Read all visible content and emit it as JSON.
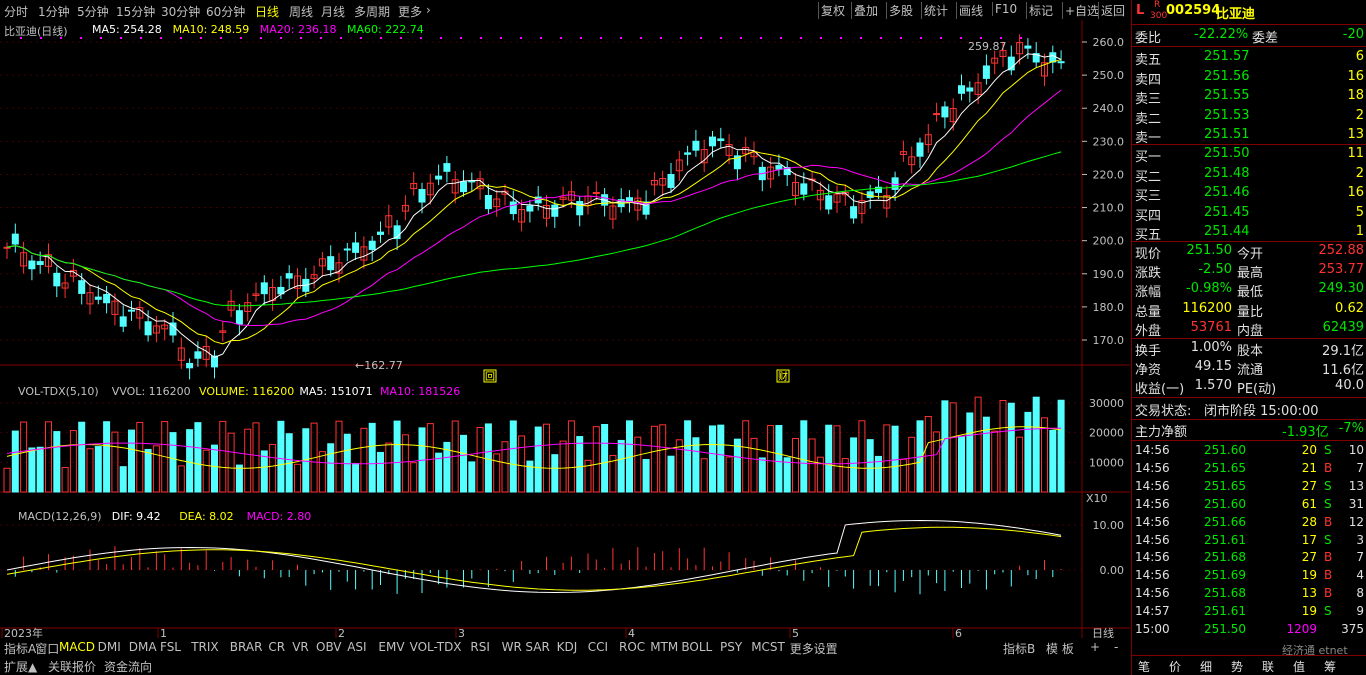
{
  "toolbar": {
    "timeframes": [
      "分时",
      "1分钟",
      "5分钟",
      "15分钟",
      "30分钟",
      "60分钟",
      "日线",
      "周线",
      "月线",
      "多周期",
      "更多"
    ],
    "active_timeframe": "日线",
    "buttons": [
      "复权",
      "叠加",
      "多股",
      "统计",
      "画线",
      "F10",
      "标记",
      "+自选",
      "返回"
    ]
  },
  "chart": {
    "title": "比亚迪(日线)",
    "ma_legend": [
      {
        "label": "MA5: 254.28",
        "color": "#ffffff"
      },
      {
        "label": "MA10: 248.59",
        "color": "#ffff00"
      },
      {
        "label": "MA20: 236.18",
        "color": "#ff00ff"
      },
      {
        "label": "MA60: 222.74",
        "color": "#00ff00"
      }
    ],
    "high_label": "259.87",
    "low_label": "162.77",
    "event_markers": [
      "回",
      "财"
    ],
    "price_ticks": [
      "260.0",
      "250.0",
      "240.0",
      "230.0",
      "220.0",
      "210.0",
      "200.0",
      "190.0",
      "180.0",
      "170.0"
    ],
    "vol_legend": [
      {
        "label": "VOL-TDX(5,10)",
        "color": "#c0c0c0"
      },
      {
        "label": "VVOL: 116200",
        "color": "#c0c0c0"
      },
      {
        "label": "VOLUME: 116200",
        "color": "#ffff00"
      },
      {
        "label": "MA5: 151071",
        "color": "#ffffff"
      },
      {
        "label": "MA10: 181526",
        "color": "#ff00ff"
      }
    ],
    "vol_ticks": [
      "30000",
      "20000",
      "10000"
    ],
    "vol_unit": "X10",
    "macd_legend": [
      {
        "label": "MACD(12,26,9)",
        "color": "#c0c0c0"
      },
      {
        "label": "DIF: 9.42",
        "color": "#ffffff"
      },
      {
        "label": "DEA: 8.02",
        "color": "#ffff00"
      },
      {
        "label": "MACD: 2.80",
        "color": "#ff00ff"
      }
    ],
    "macd_ticks": [
      "10.00",
      "0.00"
    ],
    "x_labels": [
      "2023年",
      "1",
      "2",
      "3",
      "4",
      "5",
      "6"
    ],
    "x_axis_unit": "日线"
  },
  "bottom": {
    "indicators": [
      "指标A",
      "窗口",
      "MACD",
      "DMI",
      "DMA",
      "FSL",
      "TRIX",
      "BRAR",
      "CR",
      "VR",
      "OBV",
      "ASI",
      "EMV",
      "VOL-TDX",
      "RSI",
      "WR",
      "SAR",
      "KDJ",
      "CCI",
      "ROC",
      "MTM",
      "BOLL",
      "PSY",
      "MCST",
      "更多",
      "设置"
    ],
    "active_indicator": "MACD",
    "right_tabs": [
      "指标B",
      "模 板"
    ],
    "row2": [
      "扩展▲",
      "关联报价",
      "资金流向"
    ],
    "corner": [
      "+",
      "-"
    ]
  },
  "quote": {
    "badge": "L",
    "r_mark": "R",
    "index_mark": "300",
    "code": "002594",
    "name": "比亚迪",
    "weibi_label": "委比",
    "weibi": "-22.22%",
    "weicha_label": "委差",
    "weicha": "-20",
    "asks": [
      {
        "label": "卖五",
        "price": "251.57",
        "vol": "6"
      },
      {
        "label": "卖四",
        "price": "251.56",
        "vol": "16"
      },
      {
        "label": "卖三",
        "price": "251.55",
        "vol": "18"
      },
      {
        "label": "卖二",
        "price": "251.53",
        "vol": "2"
      },
      {
        "label": "卖一",
        "price": "251.51",
        "vol": "13"
      }
    ],
    "bids": [
      {
        "label": "买一",
        "price": "251.50",
        "vol": "11"
      },
      {
        "label": "买二",
        "price": "251.48",
        "vol": "2"
      },
      {
        "label": "买三",
        "price": "251.46",
        "vol": "16"
      },
      {
        "label": "买四",
        "price": "251.45",
        "vol": "5"
      },
      {
        "label": "买五",
        "price": "251.44",
        "vol": "1"
      }
    ],
    "stats": [
      {
        "l1": "现价",
        "v1": "251.50",
        "l2": "今开",
        "v2": "252.88"
      },
      {
        "l1": "涨跌",
        "v1": "-2.50",
        "l2": "最高",
        "v2": "253.77"
      },
      {
        "l1": "涨幅",
        "v1": "-0.98%",
        "l2": "最低",
        "v2": "249.30"
      },
      {
        "l1": "总量",
        "v1": "116200",
        "l2": "量比",
        "v2": "0.62"
      },
      {
        "l1": "外盘",
        "v1": "53761",
        "l2": "内盘",
        "v2": "62439"
      }
    ],
    "stats2": [
      {
        "l1": "换手",
        "v1": "1.00%",
        "l2": "股本",
        "v2": "29.1亿"
      },
      {
        "l1": "净资",
        "v1": "49.15",
        "l2": "流通",
        "v2": "11.6亿"
      },
      {
        "l1": "收益(一)",
        "v1": "1.570",
        "l2": "PE(动)",
        "v2": "40.0"
      }
    ],
    "status_label": "交易状态:",
    "status": "闭市阶段 15:00:00",
    "flow_label": "主力净额",
    "flow": "-1.93亿",
    "flow_pct": "-7%",
    "ticks": [
      {
        "t": "14:56",
        "p": "251.60",
        "v": "20",
        "d": "S",
        "n": "10"
      },
      {
        "t": "14:56",
        "p": "251.65",
        "v": "21",
        "d": "B",
        "n": "7"
      },
      {
        "t": "14:56",
        "p": "251.65",
        "v": "27",
        "d": "S",
        "n": "13"
      },
      {
        "t": "14:56",
        "p": "251.60",
        "v": "61",
        "d": "S",
        "n": "31"
      },
      {
        "t": "14:56",
        "p": "251.66",
        "v": "28",
        "d": "B",
        "n": "12"
      },
      {
        "t": "14:56",
        "p": "251.61",
        "v": "17",
        "d": "S",
        "n": "3"
      },
      {
        "t": "14:56",
        "p": "251.68",
        "v": "27",
        "d": "B",
        "n": "7"
      },
      {
        "t": "14:56",
        "p": "251.69",
        "v": "19",
        "d": "B",
        "n": "4"
      },
      {
        "t": "14:56",
        "p": "251.68",
        "v": "13",
        "d": "B",
        "n": "8"
      },
      {
        "t": "14:57",
        "p": "251.61",
        "v": "19",
        "d": "S",
        "n": "9"
      },
      {
        "t": "15:00",
        "p": "251.50",
        "v": "1209",
        "d": "",
        "n": "375"
      }
    ],
    "footer_tabs": [
      "笔",
      "价",
      "细",
      "势",
      "联",
      "值",
      "筹"
    ],
    "watermark": "经济通 etnet"
  }
}
